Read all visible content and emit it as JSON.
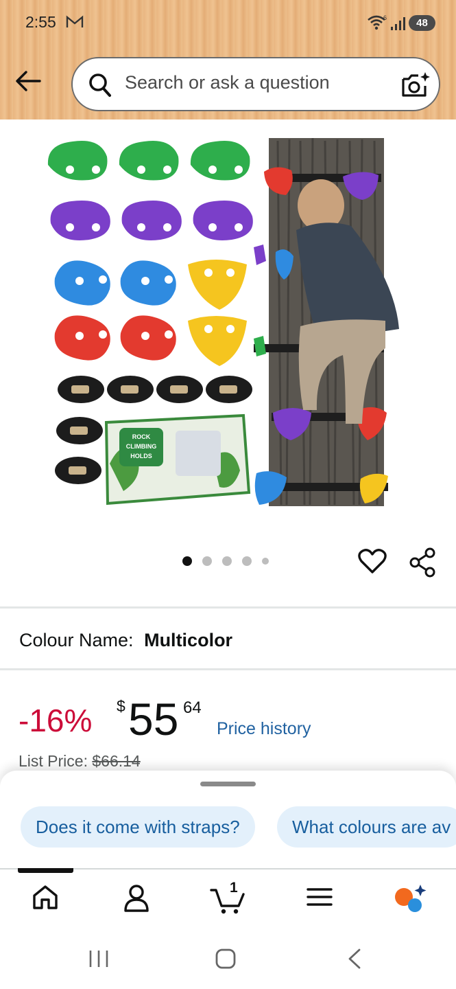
{
  "status_bar": {
    "time": "2:55",
    "battery": "48",
    "mail_icon": "gmail-icon",
    "wifi_icon": "wifi-icon",
    "signal_icon": "signal-icon"
  },
  "search": {
    "placeholder": "Search or ask a question"
  },
  "product": {
    "image_description_icon": "product-image",
    "image_box_text": [
      "ROCK",
      "CLIMBING",
      "HOLDS"
    ],
    "carousel": {
      "total": 5,
      "active_index": 0
    }
  },
  "colour": {
    "label": "Colour Name:",
    "value": "Multicolor"
  },
  "price": {
    "discount": "-16%",
    "currency": "$",
    "whole": "55",
    "fraction": "64",
    "history_label": "Price history",
    "list_label": "List Price:",
    "list_value": "$66.14"
  },
  "suggestions": [
    "Does it come with straps?",
    "What colours are av"
  ],
  "bottom_nav": {
    "items": [
      "home-icon",
      "account-icon",
      "cart-icon",
      "menu-icon",
      "rufus-icon"
    ],
    "cart_count": "1",
    "active_index": 0
  },
  "colors": {
    "header": "#efc290",
    "discount": "#cc0c39",
    "link": "#2162a1",
    "chip_bg": "#e3f0fb"
  }
}
